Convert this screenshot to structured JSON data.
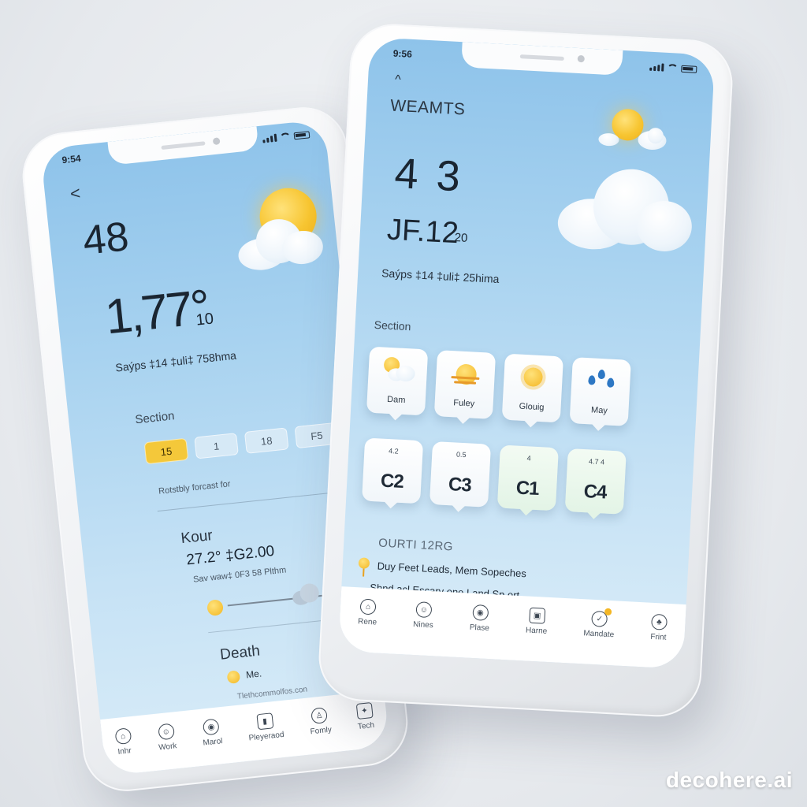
{
  "left_phone": {
    "status_time": "9:54",
    "back_glyph": "<",
    "headline_number": "48",
    "temperature": "1,77°",
    "temperature_sub": "10",
    "summary": "Saýps ‡14 ‡uli‡ 758hma",
    "section_label": "Section",
    "pills": [
      "15",
      "1",
      "18",
      "F5"
    ],
    "forecast_caption": "Rotstbly forcast for",
    "kour_title": "Kour",
    "kour_value": "27.2° ‡G2.00",
    "kour_sub": "Sav waw‡ 0F3 58 Plthm",
    "slider_level": 0.55,
    "death_title": "Death",
    "death_item": "Me.",
    "death_caption": "Tlethcommolfos.con",
    "tabs": [
      {
        "label": "Inhr",
        "icon": "home-icon"
      },
      {
        "label": "Work",
        "icon": "person-icon"
      },
      {
        "label": "Marol",
        "icon": "face-icon"
      },
      {
        "label": "Pleyeraod",
        "icon": "grid-icon"
      },
      {
        "label": "Fomly",
        "icon": "people-icon"
      },
      {
        "label": "Tech",
        "icon": "chip-icon"
      }
    ]
  },
  "right_phone": {
    "status_time": "9:56",
    "up_glyph": "^",
    "app_title": "WEAMTS",
    "headline_number": "4 3",
    "date_text": "JF.12",
    "date_sub": "20",
    "summary": "Saýps ‡14 ‡uli‡ 25hima",
    "section_label": "Section",
    "weather_cards": [
      {
        "label": "Dam",
        "icon": "sun-cloud-icon"
      },
      {
        "label": "Fuley",
        "icon": "sunset-icon"
      },
      {
        "label": "Glouig",
        "icon": "sun-icon"
      },
      {
        "label": "May",
        "icon": "rain-icon"
      }
    ],
    "value_cards": [
      {
        "top": "4.2",
        "big": "C2",
        "tint": "white"
      },
      {
        "top": "0.5",
        "big": "C3",
        "tint": "white"
      },
      {
        "top": "4",
        "big": "C1",
        "tint": "green"
      },
      {
        "top": "4.7 4",
        "big": "C4",
        "tint": "green"
      }
    ],
    "info_title": "OURTI 12RG",
    "info_line_1": "Duy Feet Leads, Mem Sopeches",
    "info_line_2": "Shnd acl Escary one Land Sp ort",
    "tabs": [
      {
        "label": "Rene",
        "icon": "home-icon"
      },
      {
        "label": "Nines",
        "icon": "person-icon"
      },
      {
        "label": "Plase",
        "icon": "face-icon"
      },
      {
        "label": "Harne",
        "icon": "grid-icon"
      },
      {
        "label": "Mandate",
        "icon": "badge-icon"
      },
      {
        "label": "Frint",
        "icon": "clover-icon"
      }
    ]
  },
  "watermark": "decohere.ai",
  "colors": {
    "sky_top": "#8ec3ea",
    "sky_bottom": "#d9ecf8",
    "sun": "#f7c531",
    "active_pill": "#f4c83a",
    "tab_bg": "#ffffff"
  }
}
